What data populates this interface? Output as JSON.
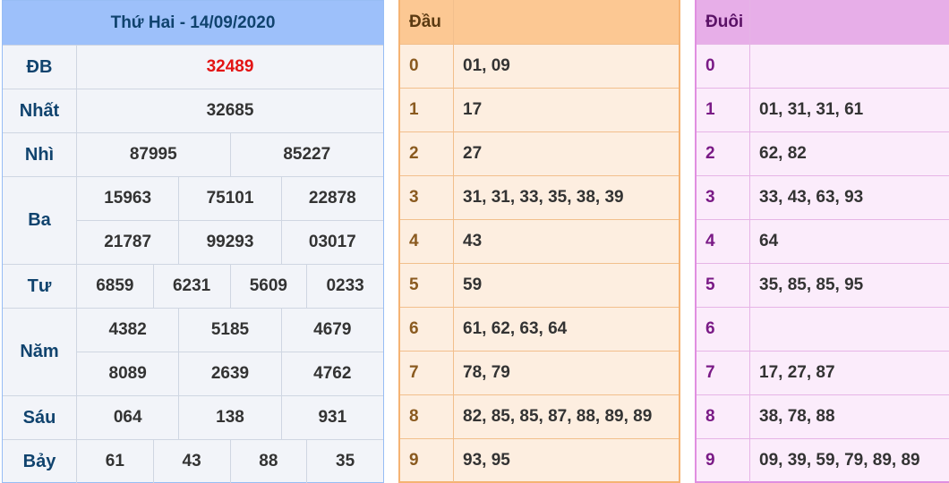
{
  "results": {
    "title": "Thứ Hai - 14/09/2020",
    "prizes": [
      {
        "label": "ĐB",
        "rows": [
          [
            "32489"
          ]
        ]
      },
      {
        "label": "Nhất",
        "rows": [
          [
            "32685"
          ]
        ]
      },
      {
        "label": "Nhì",
        "rows": [
          [
            "87995",
            "85227"
          ]
        ]
      },
      {
        "label": "Ba",
        "rows": [
          [
            "15963",
            "75101",
            "22878"
          ],
          [
            "21787",
            "99293",
            "03017"
          ]
        ]
      },
      {
        "label": "Tư",
        "rows": [
          [
            "6859",
            "6231",
            "5609",
            "0233"
          ]
        ]
      },
      {
        "label": "Năm",
        "rows": [
          [
            "4382",
            "5185",
            "4679"
          ],
          [
            "8089",
            "2639",
            "4762"
          ]
        ]
      },
      {
        "label": "Sáu",
        "rows": [
          [
            "064",
            "138",
            "931"
          ]
        ]
      },
      {
        "label": "Bảy",
        "rows": [
          [
            "61",
            "43",
            "88",
            "35"
          ]
        ]
      }
    ]
  },
  "dau": {
    "header": "Đầu",
    "rows": [
      {
        "key": "0",
        "values": "01, 09"
      },
      {
        "key": "1",
        "values": "17"
      },
      {
        "key": "2",
        "values": "27"
      },
      {
        "key": "3",
        "values": "31, 31, 33, 35, 38, 39"
      },
      {
        "key": "4",
        "values": "43"
      },
      {
        "key": "5",
        "values": "59"
      },
      {
        "key": "6",
        "values": "61, 62, 63, 64"
      },
      {
        "key": "7",
        "values": "78, 79"
      },
      {
        "key": "8",
        "values": "82, 85, 85, 87, 88, 89, 89"
      },
      {
        "key": "9",
        "values": "93, 95"
      }
    ]
  },
  "duoi": {
    "header": "Đuôi",
    "rows": [
      {
        "key": "0",
        "values": ""
      },
      {
        "key": "1",
        "values": "01, 31, 31, 61"
      },
      {
        "key": "2",
        "values": "62, 82"
      },
      {
        "key": "3",
        "values": "33, 43, 63, 93"
      },
      {
        "key": "4",
        "values": "64"
      },
      {
        "key": "5",
        "values": "35, 85, 85, 95"
      },
      {
        "key": "6",
        "values": ""
      },
      {
        "key": "7",
        "values": "17, 27, 87"
      },
      {
        "key": "8",
        "values": "38, 78, 88"
      },
      {
        "key": "9",
        "values": "09, 39, 59, 79, 89, 89"
      }
    ]
  },
  "colors": {
    "results_header_bg": "#9dc0fa",
    "special_prize": "#e31414",
    "dau_header_bg": "#fcc893",
    "duoi_header_bg": "#e7aee8"
  }
}
